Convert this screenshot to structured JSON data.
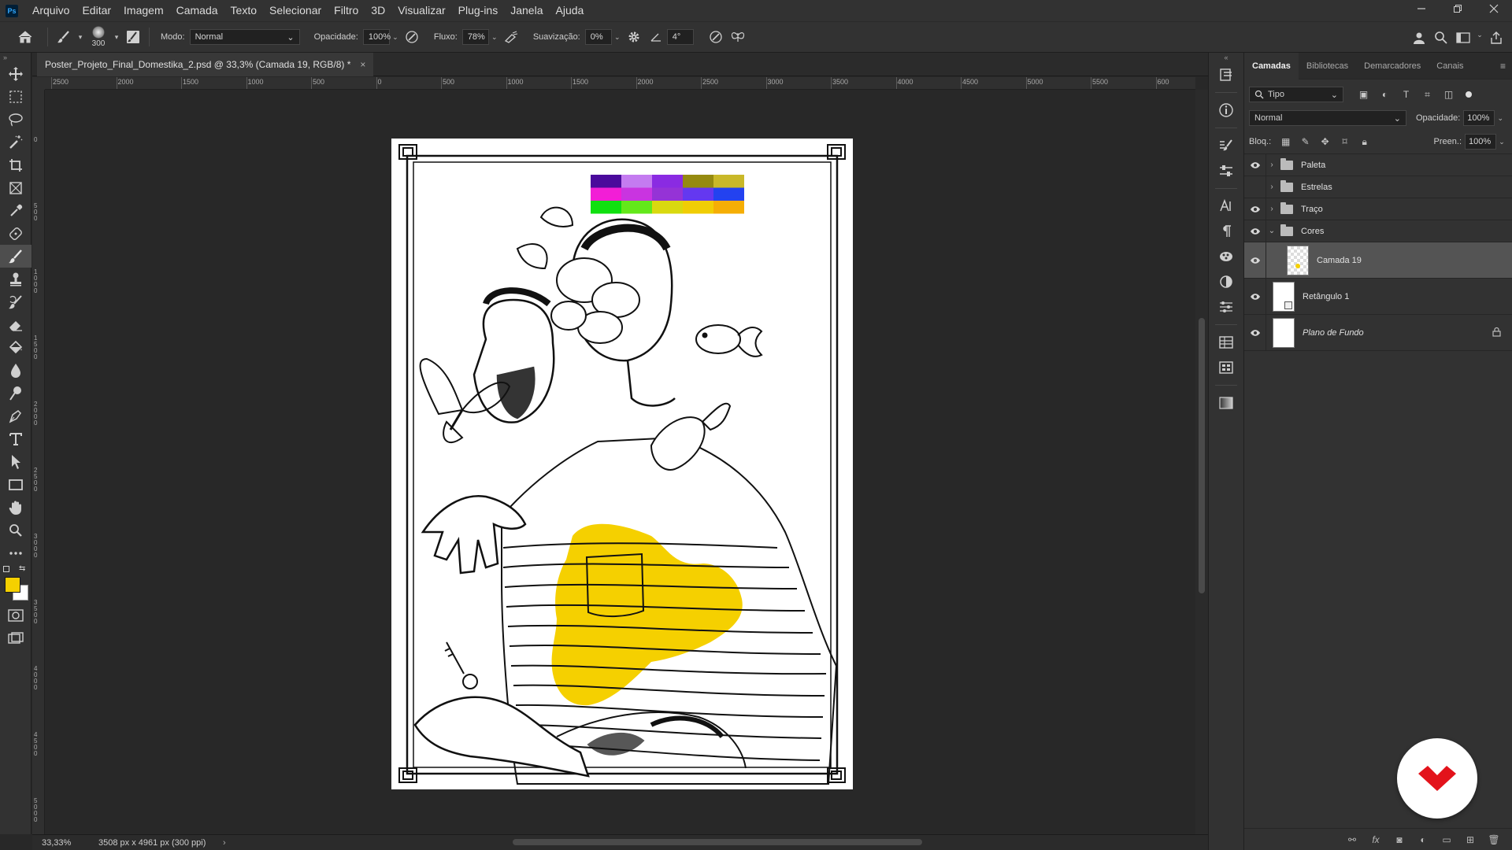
{
  "app": {
    "logo": "Ps"
  },
  "menu": [
    "Arquivo",
    "Editar",
    "Imagem",
    "Camada",
    "Texto",
    "Selecionar",
    "Filtro",
    "3D",
    "Visualizar",
    "Plug-ins",
    "Janela",
    "Ajuda"
  ],
  "options": {
    "brush_size": "300",
    "mode_label": "Modo:",
    "mode_value": "Normal",
    "opacity_label": "Opacidade:",
    "opacity_value": "100%",
    "flow_label": "Fluxo:",
    "flow_value": "78%",
    "smoothing_label": "Suavização:",
    "smoothing_value": "0%",
    "angle_value": "4°"
  },
  "document": {
    "tab_title": "Poster_Projeto_Final_Domestika_2.psd @ 33,3% (Camada 19, RGB/8) *",
    "close_glyph": "×",
    "ruler_h": [
      "2500",
      "2000",
      "1500",
      "1000",
      "500",
      "0",
      "500",
      "1000",
      "1500",
      "2000",
      "2500",
      "3000",
      "3500",
      "4000",
      "4500",
      "5000",
      "5500",
      "600"
    ],
    "ruler_v": [
      "0",
      "500",
      "1000",
      "1500",
      "2000",
      "2500",
      "3000",
      "3500",
      "4000",
      "4500",
      "5000"
    ]
  },
  "status": {
    "zoom": "33,33%",
    "doc_size": "3508 px x 4961 px (300 ppi)",
    "arrow": "›"
  },
  "colors": {
    "foreground": "#f5d000",
    "background": "#ffffff",
    "palette": [
      [
        "#4a0a9c",
        "#c47bf0",
        "#8a2be2",
        "#958a10",
        "#c9b829"
      ],
      [
        "#f21ed6",
        "#c934e0",
        "#9533d6",
        "#6438f0",
        "#2342f0"
      ],
      [
        "#0fe00f",
        "#63e81a",
        "#d9d90f",
        "#f0cd05",
        "#f5ae05"
      ]
    ]
  },
  "layers_panel": {
    "tabs": [
      "Camadas",
      "Bibliotecas",
      "Demarcadores",
      "Canais"
    ],
    "filter_value": "Tipo",
    "blend_mode": "Normal",
    "opacity_label": "Opacidade:",
    "opacity_value": "100%",
    "lock_label": "Bloq.:",
    "fill_label": "Preen.:",
    "fill_value": "100%",
    "layers": [
      {
        "name": "Paleta",
        "type": "group",
        "visible": true
      },
      {
        "name": "Estrelas",
        "type": "group",
        "visible": false
      },
      {
        "name": "Traço",
        "type": "group",
        "visible": true
      },
      {
        "name": "Cores",
        "type": "group-open",
        "visible": true
      },
      {
        "name": "Camada 19",
        "type": "layer",
        "visible": true,
        "selected": true
      },
      {
        "name": "Retângulo 1",
        "type": "shape",
        "visible": true
      },
      {
        "name": "Plano de Fundo",
        "type": "background",
        "visible": true,
        "locked": true
      }
    ]
  }
}
